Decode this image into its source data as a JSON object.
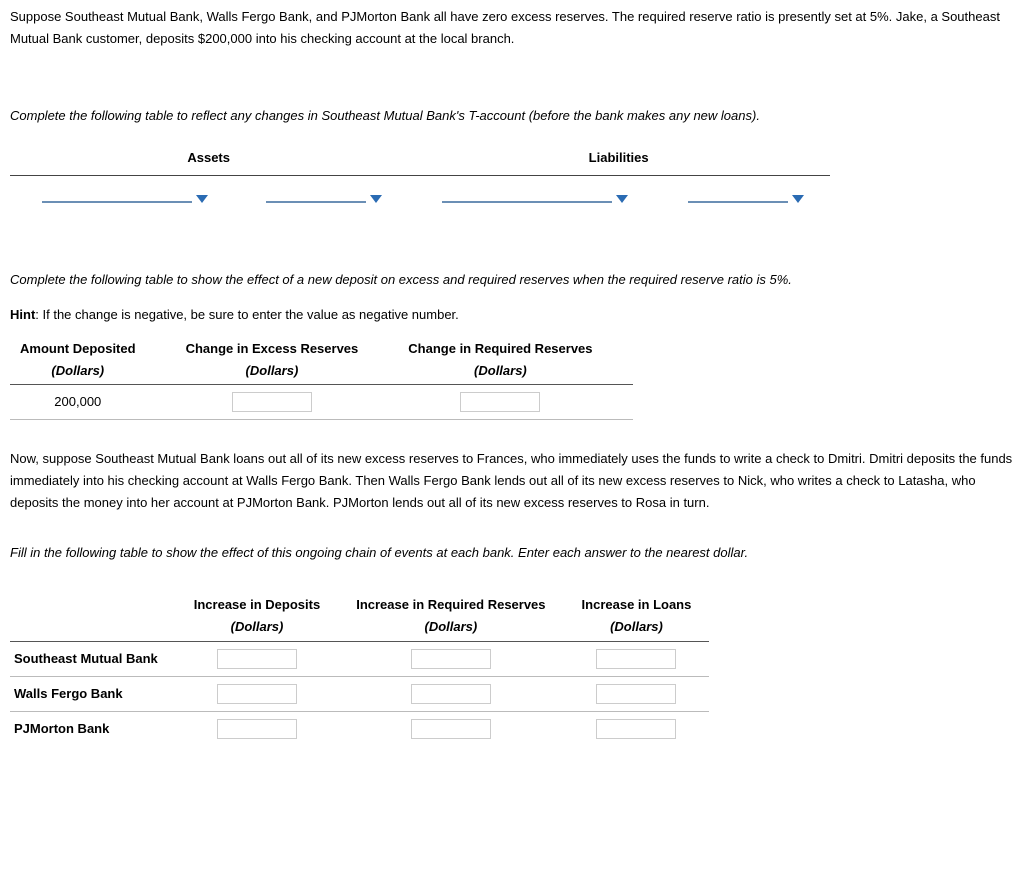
{
  "intro": "Suppose Southeast Mutual Bank, Walls Fergo Bank, and PJMorton Bank all have zero excess reserves. The required reserve ratio is presently set at 5%. Jake, a Southeast Mutual Bank customer, deposits $200,000 into his checking account at the local branch.",
  "part1": {
    "instr": "Complete the following table to reflect any changes in Southeast Mutual Bank's T-account (before the bank makes any new loans).",
    "headers": {
      "assets": "Assets",
      "liabilities": "Liabilities"
    }
  },
  "part2": {
    "instr": "Complete the following table to show the effect of a new deposit on excess and required reserves when the required reserve ratio is 5%.",
    "hint_label": "Hint",
    "hint_text": ": If the change is negative, be sure to enter the value as negative number.",
    "headers": {
      "amount": "Amount Deposited",
      "excess": "Change in Excess Reserves",
      "required": "Change in Required Reserves",
      "unit": "(Dollars)"
    },
    "amount_value": "200,000"
  },
  "part3": {
    "story": "Now, suppose Southeast Mutual Bank loans out all of its new excess reserves to Frances, who immediately uses the funds to write a check to Dmitri. Dmitri deposits the funds immediately into his checking account at Walls Fergo Bank. Then Walls Fergo Bank lends out all of its new excess reserves to Nick, who writes a check to Latasha, who deposits the money into her account at PJMorton Bank. PJMorton lends out all of its new excess reserves to Rosa in turn.",
    "instr": "Fill in the following table to show the effect of this ongoing chain of events at each bank. Enter each answer to the nearest dollar.",
    "headers": {
      "deposits": "Increase in Deposits",
      "required": "Increase in Required Reserves",
      "loans": "Increase in Loans",
      "unit": "(Dollars)"
    },
    "rows": {
      "r1": "Southeast Mutual Bank",
      "r2": "Walls Fergo Bank",
      "r3": "PJMorton Bank"
    }
  }
}
